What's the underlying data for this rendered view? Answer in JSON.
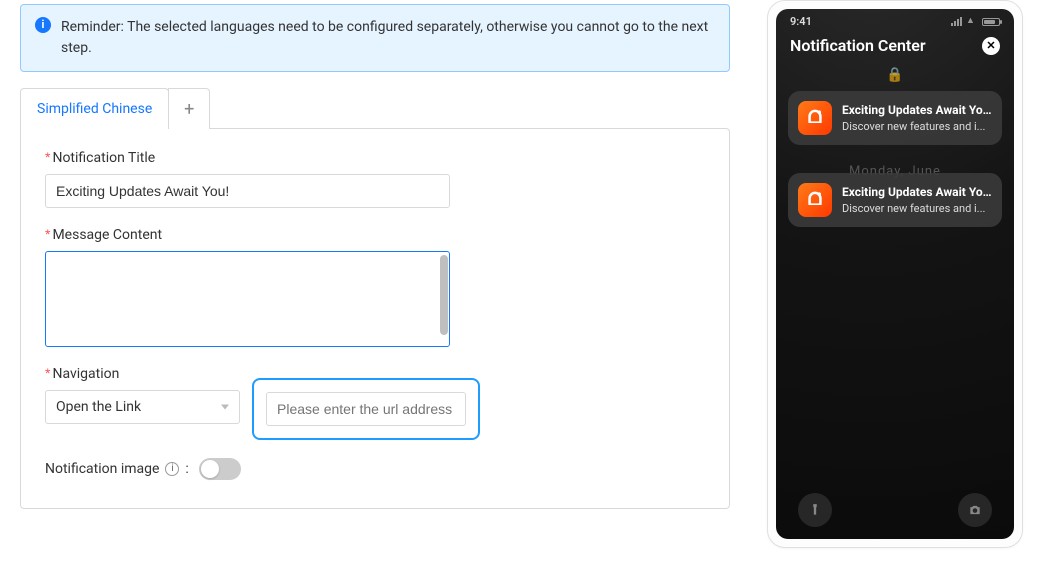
{
  "reminder": {
    "text": "Reminder: The selected languages need to be configured separately, otherwise you cannot go to the next step."
  },
  "tabs": {
    "items": [
      {
        "label": "Simplified Chinese"
      }
    ],
    "add_label": "+"
  },
  "form": {
    "title_label": "Notification Title",
    "title_value": "Exciting Updates Await You!",
    "message_label": "Message Content",
    "message_value": "",
    "navigation_label": "Navigation",
    "navigation_value": "Open the Link",
    "url_placeholder": "Please enter the url address",
    "image_label": "Notification image",
    "image_colon": ":"
  },
  "preview": {
    "time": "9:41",
    "header": "Notification Center",
    "date": "Monday, June",
    "notifications": [
      {
        "title": "Exciting Updates Await You!",
        "body": "Discover new features and i..."
      },
      {
        "title": "Exciting Updates Await You!",
        "body": "Discover new features and i..."
      }
    ]
  }
}
